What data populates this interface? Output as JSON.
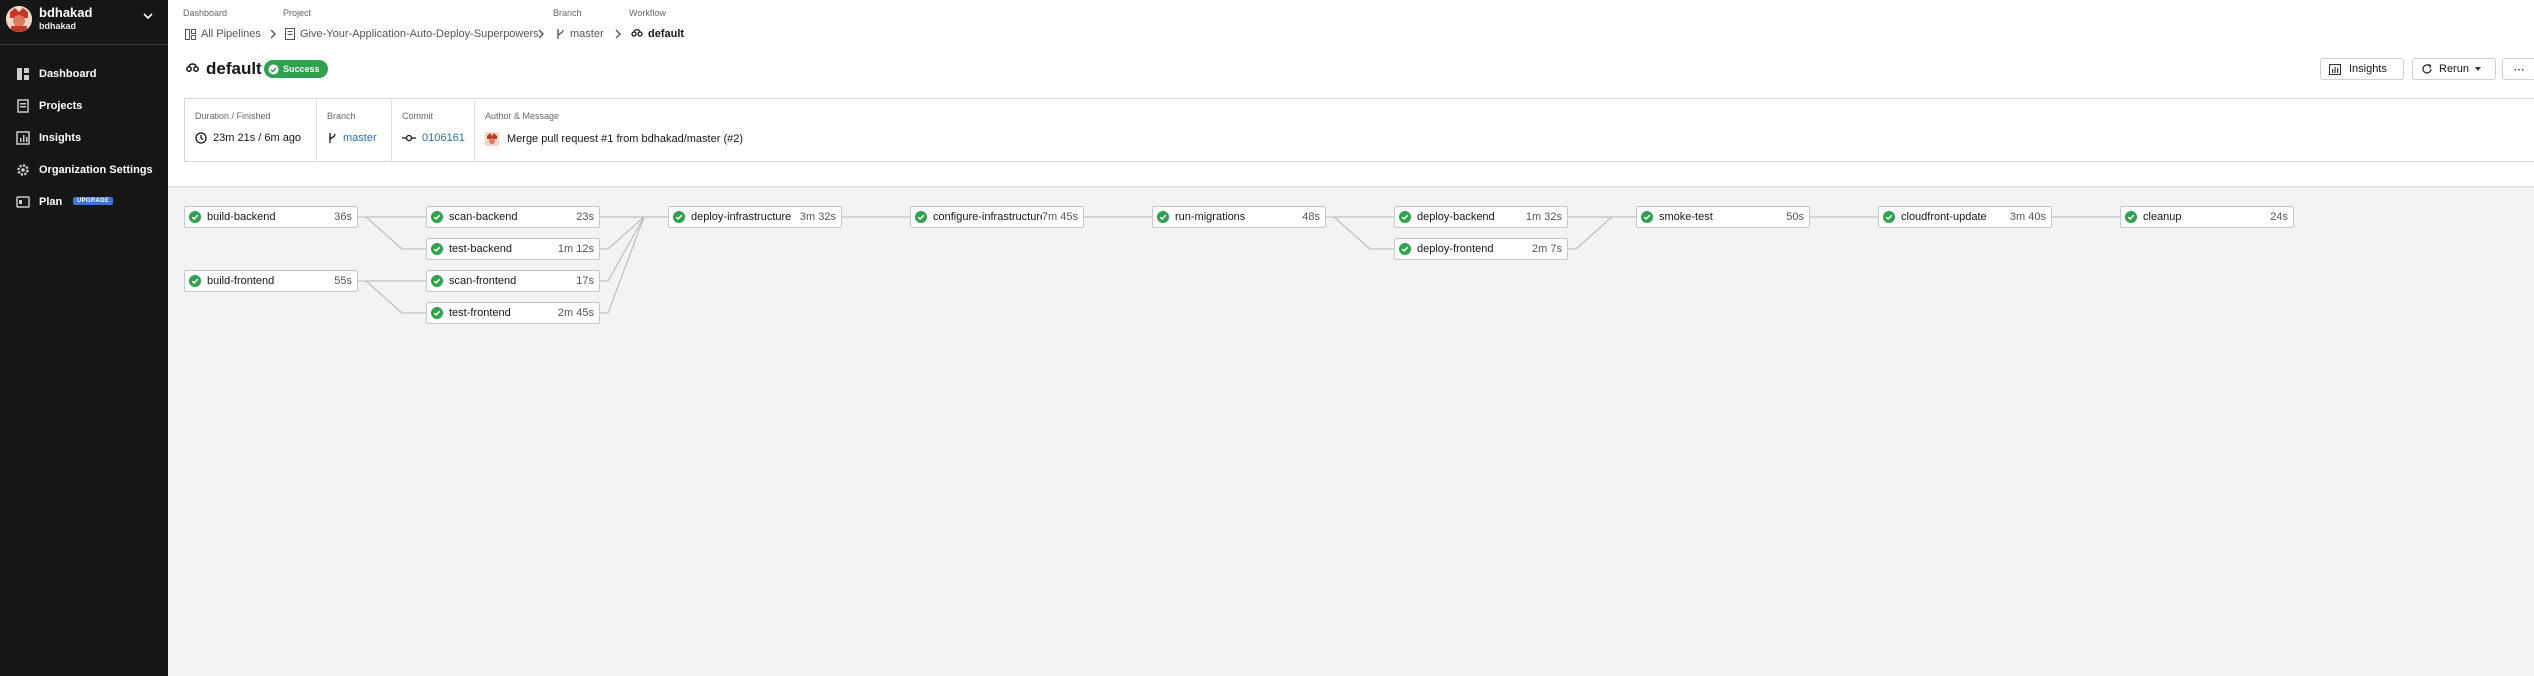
{
  "org": {
    "name": "bdhakad",
    "sub": "bdhakad"
  },
  "nav": [
    {
      "label": "Dashboard",
      "icon": "dashboard-icon"
    },
    {
      "label": "Projects",
      "icon": "projects-icon"
    },
    {
      "label": "Insights",
      "icon": "insights-icon"
    },
    {
      "label": "Organization Settings",
      "icon": "gear-icon"
    },
    {
      "label": "Plan",
      "icon": "plan-icon",
      "badge": "UPGRADE"
    }
  ],
  "breadcrumbs": {
    "dashboard": {
      "label": "Dashboard",
      "value": "All Pipelines"
    },
    "project": {
      "label": "Project",
      "value": "Give-Your-Application-Auto-Deploy-Superpowers"
    },
    "branch": {
      "label": "Branch",
      "value": "master"
    },
    "workflow": {
      "label": "Workflow",
      "value": "default"
    }
  },
  "workflow": {
    "title": "default",
    "status": "Success",
    "status_color": "#30a14e"
  },
  "actions": {
    "insights": "Insights",
    "rerun": "Rerun",
    "more": "⋯"
  },
  "info": {
    "duration": {
      "label": "Duration / Finished",
      "value": "23m 21s / 6m ago"
    },
    "branch": {
      "label": "Branch",
      "value": "master"
    },
    "commit": {
      "label": "Commit",
      "value": "0106161"
    },
    "author": {
      "label": "Author & Message",
      "value": "Merge pull request #1 from bdhakad/master (#2)"
    }
  },
  "jobs": [
    {
      "name": "build-backend",
      "duration": "36s"
    },
    {
      "name": "build-frontend",
      "duration": "55s"
    },
    {
      "name": "scan-backend",
      "duration": "23s"
    },
    {
      "name": "test-backend",
      "duration": "1m 12s"
    },
    {
      "name": "scan-frontend",
      "duration": "17s"
    },
    {
      "name": "test-frontend",
      "duration": "2m 45s"
    },
    {
      "name": "deploy-infrastructure",
      "duration": "3m 32s"
    },
    {
      "name": "configure-infrastructure",
      "duration": "7m 45s"
    },
    {
      "name": "run-migrations",
      "duration": "48s"
    },
    {
      "name": "deploy-backend",
      "duration": "1m 32s"
    },
    {
      "name": "deploy-frontend",
      "duration": "2m 7s"
    },
    {
      "name": "smoke-test",
      "duration": "50s"
    },
    {
      "name": "cloudfront-update",
      "duration": "3m 40s"
    },
    {
      "name": "cleanup",
      "duration": "24s"
    }
  ],
  "colors": {
    "success": "#30a14e",
    "sidebar": "#161616",
    "link": "#2c6db6"
  }
}
